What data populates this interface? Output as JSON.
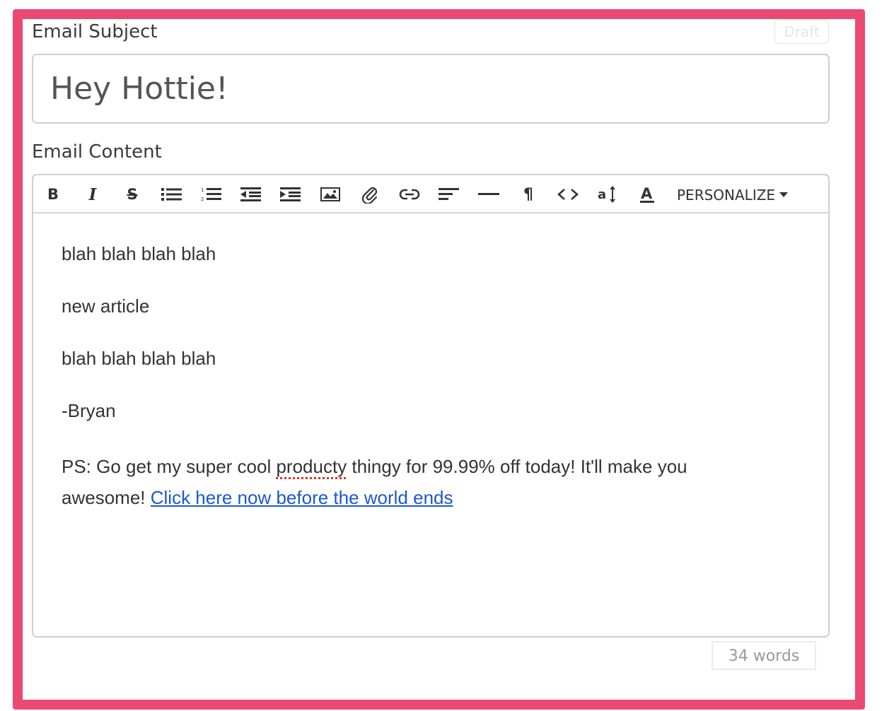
{
  "subject": {
    "label": "Email Subject",
    "status_badge": "Draft",
    "value": "Hey Hottie!"
  },
  "content": {
    "label": "Email Content",
    "toolbar": {
      "buttons": [
        "bold-icon",
        "italic-icon",
        "strikethrough-icon",
        "unordered-list-icon",
        "ordered-list-icon",
        "outdent-icon",
        "indent-icon",
        "image-icon",
        "paperclip-icon",
        "link-icon",
        "align-left-icon",
        "horizontal-rule-icon",
        "pilcrow-icon",
        "code-icon",
        "font-size-icon",
        "font-color-icon"
      ],
      "personalize_label": "PERSONALIZE"
    },
    "body": {
      "p1": "blah blah blah blah",
      "p2": "new article",
      "p3": "blah blah blah blah",
      "p4": "-Bryan",
      "p5_before": "PS: Go get my super cool ",
      "p5_misspelled": "producty",
      "p5_after": " thingy for 99.99% off today! It'll make you awesome! ",
      "p5_link": "Click here now before the world ends"
    },
    "word_count": "34 words"
  },
  "colors": {
    "frame": "#ea4a72",
    "link": "#1b58d3",
    "spellcheck": "#e03030"
  }
}
